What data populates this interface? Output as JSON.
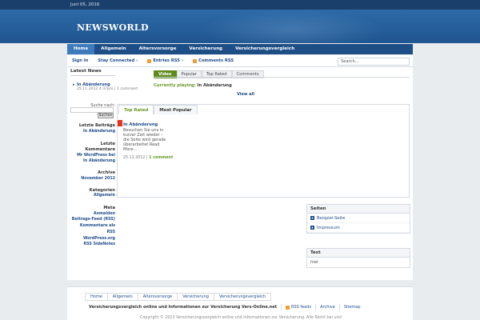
{
  "topbar": {
    "date": "Juni 05, 2016"
  },
  "header": {
    "logo": "NEWSWORLD"
  },
  "nav": [
    "Home",
    "Allgemein",
    "Altersvorsorge",
    "Versicherung",
    "Versicherungsvergleich"
  ],
  "subnav": {
    "signin": "Sign In",
    "stay": "Stay Connected",
    "entries": "Entries RSS",
    "comments": "Comments RSS"
  },
  "search": {
    "placeholder": "Search..."
  },
  "latest": {
    "heading": "Latest News",
    "title": "In Abänderung",
    "meta_date": "25.11.2012 4:37pm",
    "meta_comment": "1 comment"
  },
  "sidebar": {
    "search_label": "Suche nach:",
    "search_btn": "Suchen",
    "recent_head": "Letzte Beiträge",
    "recent_item": "In Abänderung",
    "comments_head1": "Letzte",
    "comments_head2": "Kommentare",
    "comments_item1": "Mr WordPress bei",
    "comments_item2": "In Abänderung",
    "archive_head": "Archive",
    "archive_item": "November 2012",
    "cat_head": "Kategorien",
    "cat_item": "Allgemein",
    "meta_head": "Meta",
    "meta_1": "Anmelden",
    "meta_2": "Beitrags-Feed (RSS)",
    "meta_3": "Kommentare als",
    "meta_4": "RSS",
    "meta_5": "WordPress.org",
    "meta_6": "RSS SideNotes"
  },
  "video": {
    "tabs": [
      "Video",
      "Popular",
      "Top Rated",
      "Comments"
    ],
    "playing_label": "Currently playing:",
    "playing_title": "In Abänderung",
    "view_all": "View all"
  },
  "panel": {
    "tabs": [
      "Top Rated",
      "Most Popular"
    ],
    "title": "In Abänderung",
    "text": "Besuchen Sie uns in kurzer Zeit wieder – die Seite wird gerade überarbeitet Read More...",
    "date": "25.11.2012",
    "comments": "1 comment"
  },
  "widgets": {
    "pages_head": "Seiten",
    "page1": "Beispiel-Seite",
    "page2": "Impressum",
    "text_head": "Text",
    "text_body": "hier"
  },
  "footer": {
    "nav": [
      "Home",
      "Allgemein",
      "Altersvorsorge",
      "Versicherung",
      "Versicherungsvergleich"
    ],
    "tagline": "Versicherungsvergleich online und Informationen zur Versicherung Vers-Online.net",
    "rss": "RSS feeds",
    "archive": "Archive",
    "sitemap": "Sitemap",
    "copyright": "Copyright © 2013 Versicherungsvergleich online und Informationen zur Versicherung. Alle Recht bei uns!"
  },
  "colors": {
    "header": "#1f5590",
    "nav": "#1d4f86",
    "accent": "#6a9a24",
    "link": "#1f4e8c"
  }
}
